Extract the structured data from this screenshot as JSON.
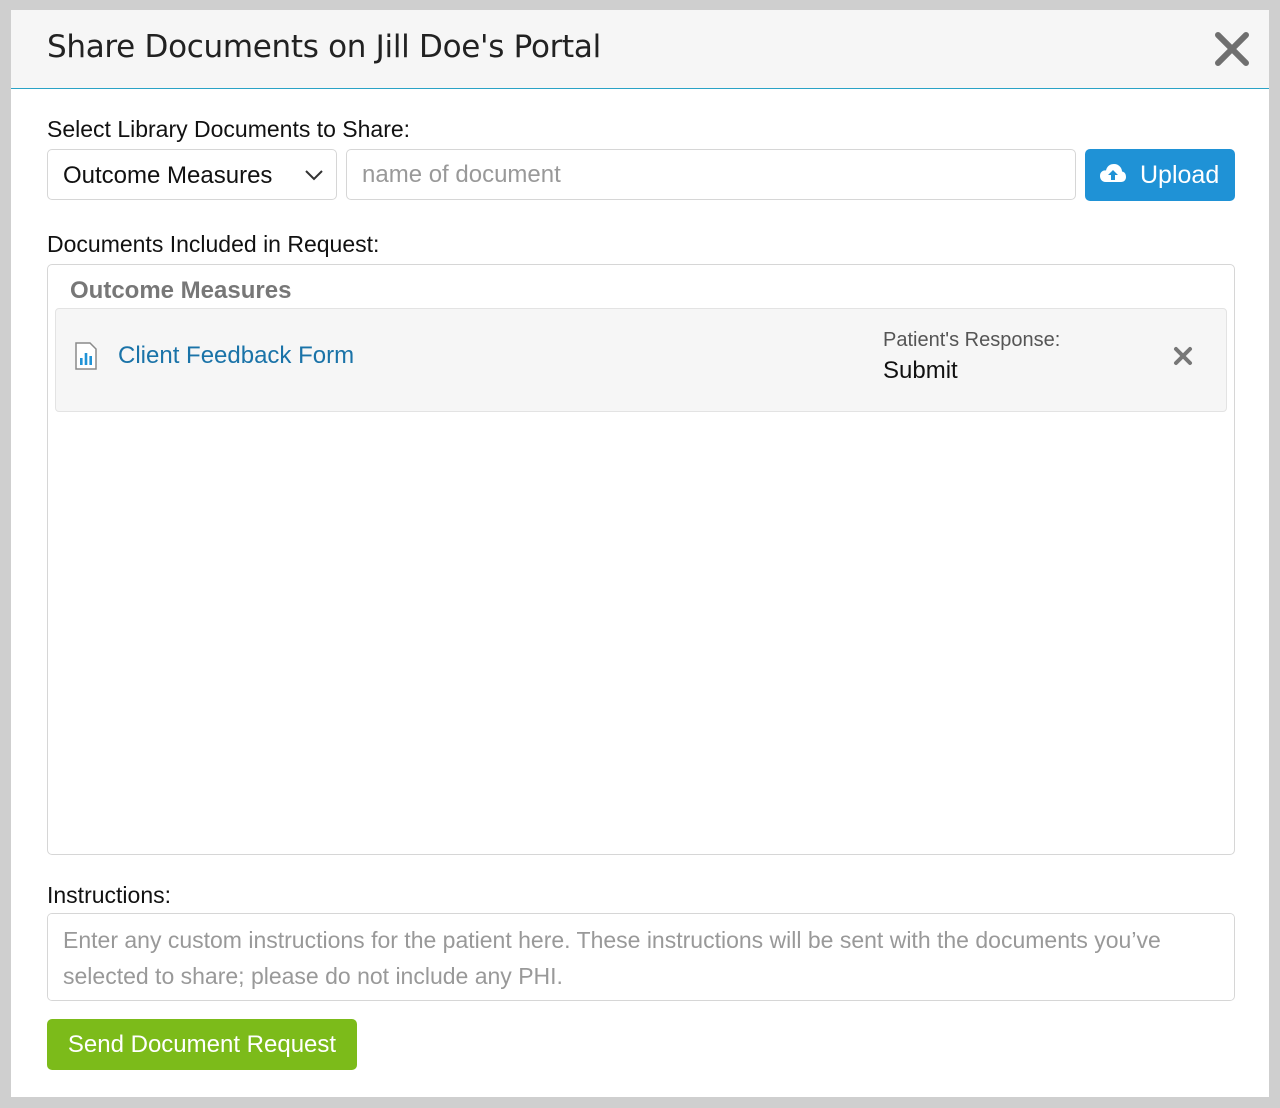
{
  "modal": {
    "title": "Share Documents on Jill Doe's Portal"
  },
  "library": {
    "label": "Select Library Documents to Share:",
    "category_selected": "Outcome Measures",
    "search_placeholder": "name of document",
    "upload_label": "Upload"
  },
  "included": {
    "label": "Documents Included in Request:",
    "groups": [
      {
        "title": "Outcome Measures",
        "documents": [
          {
            "name": "Client Feedback Form",
            "icon": "bar-chart-document-icon",
            "response_label": "Patient's Response:",
            "response_value": "Submit"
          }
        ]
      }
    ]
  },
  "instructions": {
    "label": "Instructions:",
    "placeholder": "Enter any custom instructions for the patient here. These instructions will be sent with the documents you’ve selected to share; please do not include any PHI."
  },
  "actions": {
    "send_label": "Send Document Request"
  },
  "colors": {
    "header_border": "#2aa3c6",
    "upload_button": "#1f92d6",
    "send_button": "#7cbb1a",
    "link": "#1a73a8"
  }
}
